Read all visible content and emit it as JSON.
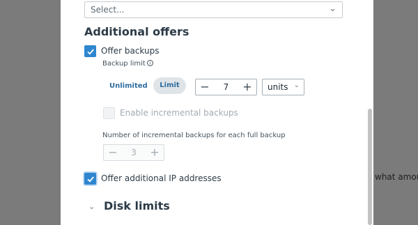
{
  "backdrop": {
    "partial_text": "what amou"
  },
  "dialog": {
    "select": {
      "placeholder": "Select...",
      "icon": "chevron-down-icon"
    },
    "additional_offers": {
      "heading": "Additional offers",
      "offer_backups": {
        "label": "Offer backups",
        "checked": true,
        "backup_limit": {
          "label": "Backup limit",
          "info_icon": "info-icon",
          "options": [
            "Unlimited",
            "Limit"
          ],
          "selected": "Limit",
          "value": "7",
          "minus": "—",
          "plus": "+",
          "units": "units"
        },
        "incremental": {
          "label": "Enable incremental backups",
          "checked": false,
          "disabled": true,
          "count_label": "Number of incremental backups for each full backup",
          "value": "3",
          "minus": "—",
          "plus": "+"
        }
      },
      "offer_ip": {
        "label": "Offer additional IP addresses",
        "checked": true
      }
    },
    "disk_limits": {
      "heading": "Disk limits",
      "icon": "chevron-down-icon"
    }
  },
  "colors": {
    "accent": "#2f86ce",
    "link": "#2f6d9e",
    "backdrop": "#7b7b7b"
  }
}
